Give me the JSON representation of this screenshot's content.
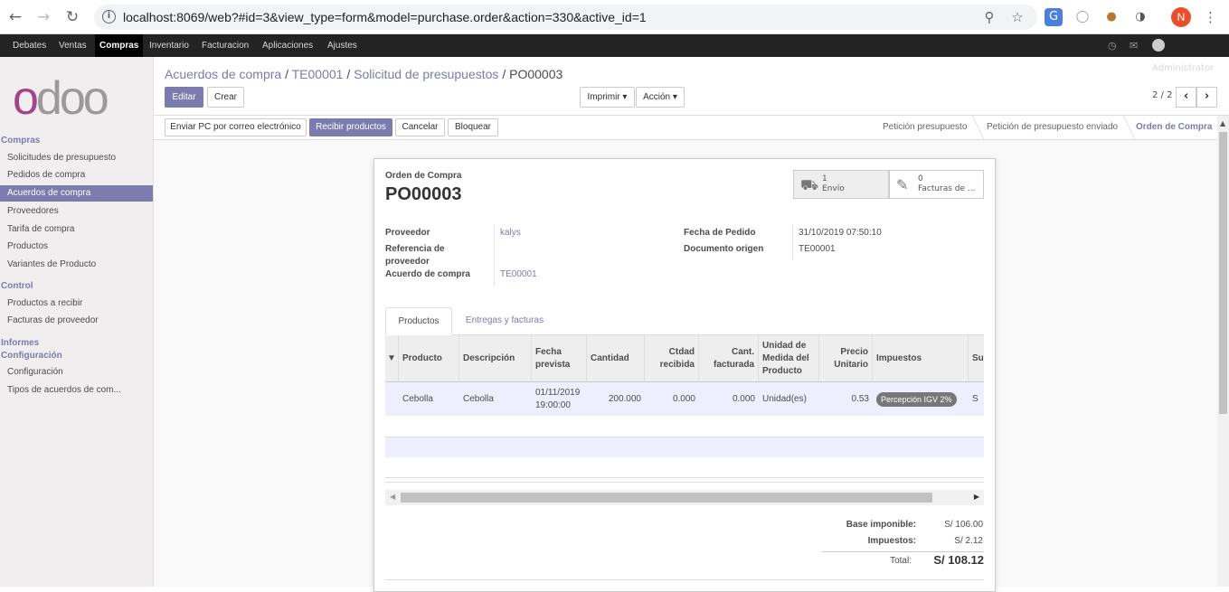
{
  "browser": {
    "url": "localhost:8069/web?#id=3&view_type=form&model=purchase.order&action=330&active_id=1",
    "profile_initial": "N"
  },
  "topmenu": {
    "items": [
      "Debates",
      "Ventas",
      "Compras",
      "Inventario",
      "Facturacion",
      "Aplicaciones",
      "Ajustes"
    ],
    "active": "Compras",
    "user": "Administrator"
  },
  "sidebar": {
    "logo": "odoo",
    "sections": {
      "compras": "Compras",
      "control": "Control",
      "informes": "Informes",
      "configuracion": "Configuración"
    },
    "items": {
      "solicitudes": "Solicitudes de presupuesto",
      "pedidos": "Pedidos de compra",
      "acuerdos": "Acuerdos de compra",
      "proveedores": "Proveedores",
      "tarifa": "Tarifa de compra",
      "productos": "Productos",
      "variantes": "Variantes de Producto",
      "recibir": "Productos a recibir",
      "facturas": "Facturas de proveedor",
      "config": "Configuración",
      "tipos": "Tipos de acuerdos de com..."
    }
  },
  "breadcrumb": {
    "items": [
      "Acuerdos de compra",
      "TE00001",
      "Solicitud de presupuestos"
    ],
    "current": "PO00003"
  },
  "toolbar": {
    "edit": "Editar",
    "create": "Crear",
    "print": "Imprimir",
    "action": "Acción",
    "pager": "2 / 2"
  },
  "header_buttons": {
    "send": "Enviar PC por correo electrónico",
    "receive": "Recibir productos",
    "cancel": "Cancelar",
    "lock": "Bloquear"
  },
  "statusbar": {
    "stages": [
      "Petición presupuesto",
      "Petición de presupuesto enviado",
      "Orden de Compra"
    ],
    "current": "Orden de Compra"
  },
  "form": {
    "type_label": "Orden de Compra",
    "name": "PO00003",
    "smart_buttons": {
      "shipments_count": "1",
      "shipments_label": "Envío",
      "invoices_count": "0",
      "invoices_label": "Facturas de ..."
    },
    "fields": {
      "proveedor_label": "Proveedor",
      "proveedor": "kalys",
      "referencia_label1": "Referencia de",
      "referencia_label2": "proveedor",
      "acuerdo_label": "Acuerdo de compra",
      "acuerdo": "TE00001",
      "fecha_label": "Fecha de Pedido",
      "fecha": "31/10/2019 07:50:10",
      "origen_label": "Documento origen",
      "origen": "TE00001"
    },
    "tabs": [
      "Productos",
      "Entregas y facturas"
    ],
    "lines": {
      "headers": {
        "producto": "Producto",
        "descripcion": "Descripción",
        "fecha1": "Fecha",
        "fecha2": "prevista",
        "cantidad": "Cantidad",
        "recibida1": "Ctdad",
        "recibida2": "recibida",
        "facturada1": "Cant.",
        "facturada2": "facturada",
        "udm1": "Unidad de",
        "udm2": "Medida del",
        "udm3": "Producto",
        "precio1": "Precio",
        "precio2": "Unitario",
        "impuestos": "Impuestos",
        "subtotal": "Su"
      },
      "row": {
        "producto": "Cebolla",
        "descripcion": "Cebolla",
        "fecha1": "01/11/2019",
        "fecha2": "19:00:00",
        "cantidad": "200.000",
        "recibida": "0.000",
        "facturada": "0.000",
        "udm": "Unidad(es)",
        "precio": "0.53",
        "impuesto": "Percepción IGV 2%",
        "subtotal": "S"
      }
    },
    "totals": {
      "base_label": "Base imponible:",
      "base": "S/ 106.00",
      "tax_label": "Impuestos:",
      "tax": "S/ 2.12",
      "total_label": "Total:",
      "total": "S/ 108.12"
    }
  },
  "colors": {
    "brand": "#7c7bad",
    "topbar": "#232323"
  }
}
